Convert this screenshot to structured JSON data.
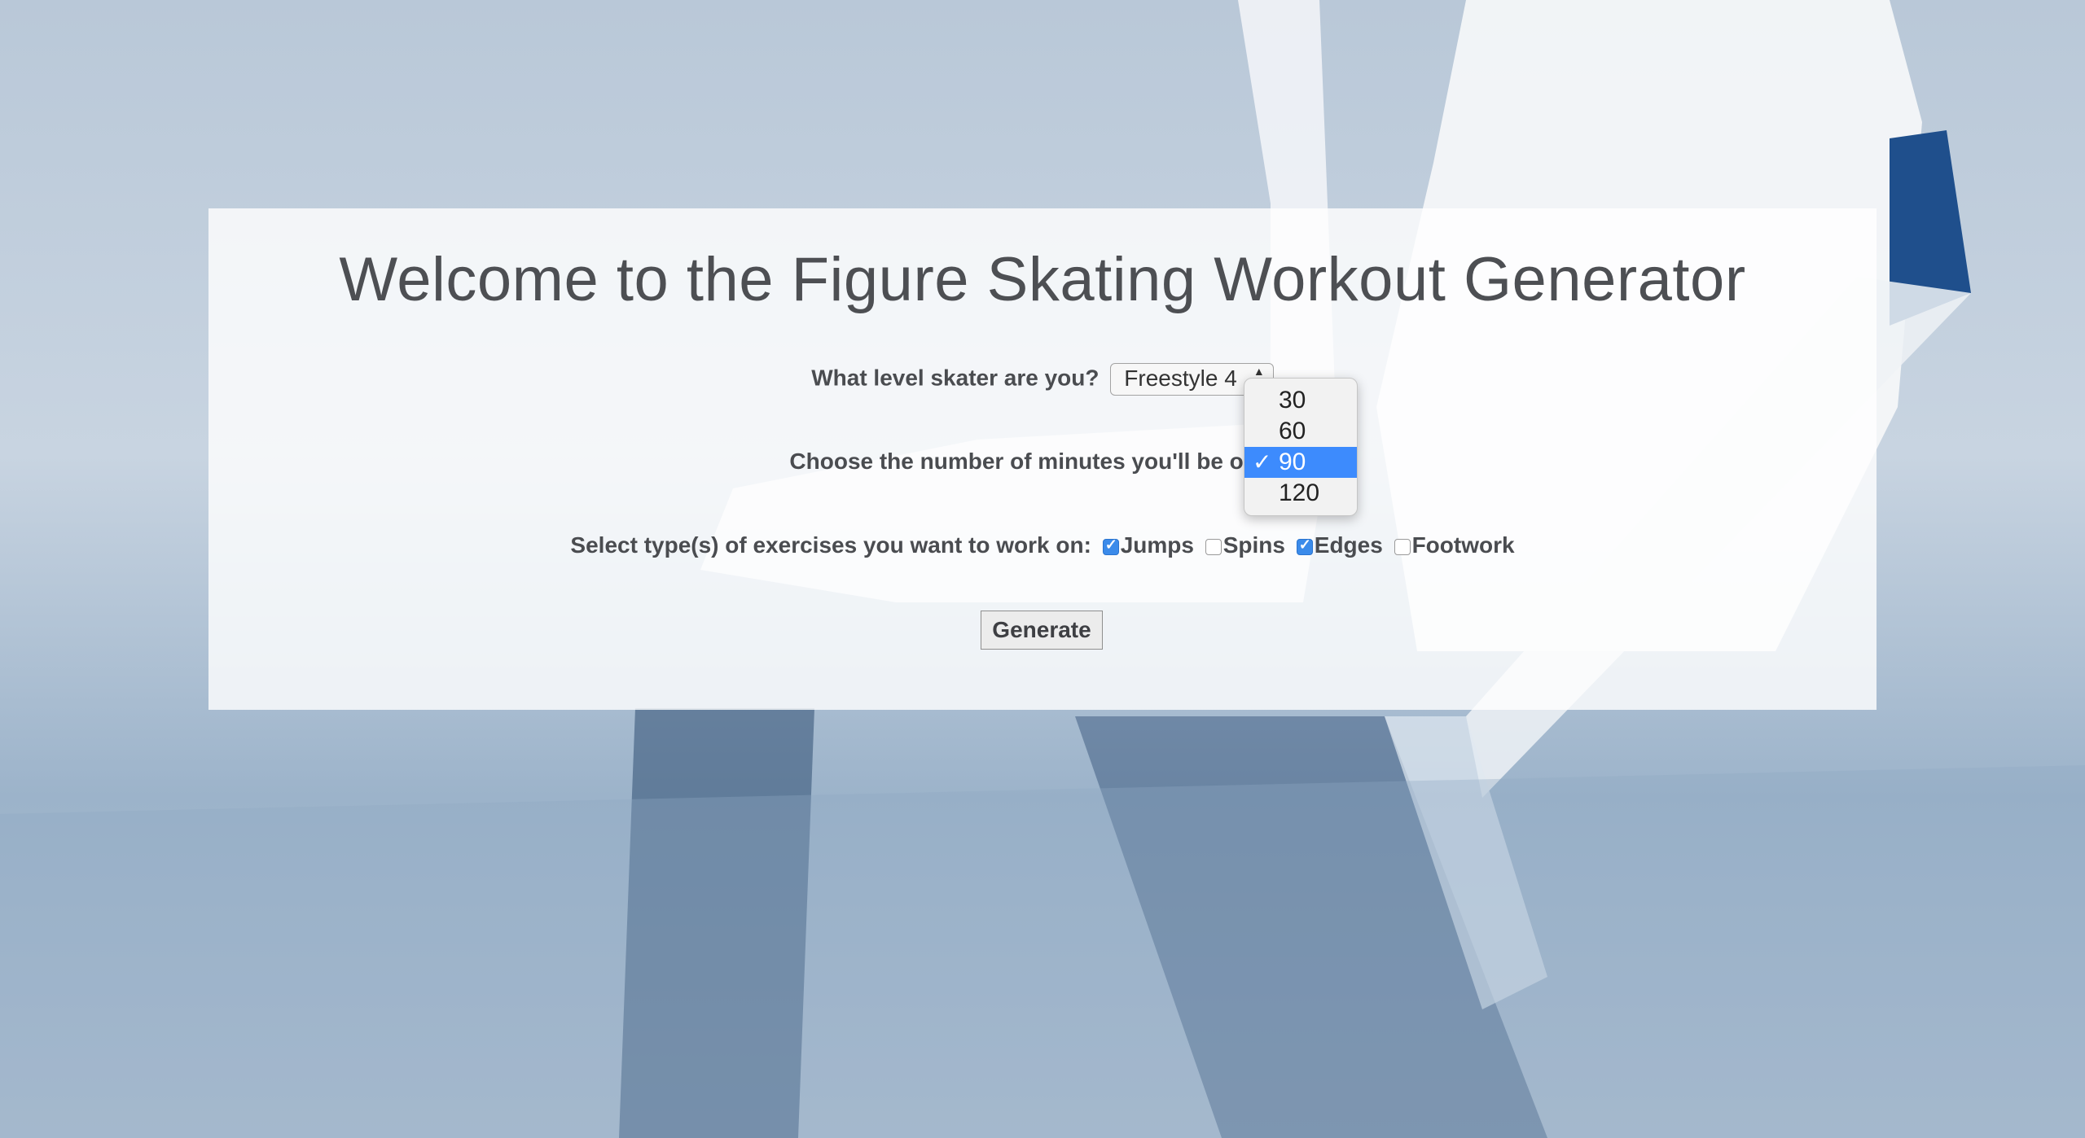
{
  "page": {
    "title": "Welcome to the Figure Skating Workout Generator"
  },
  "form": {
    "level_label": "What level skater are you?",
    "level_value": "Freestyle 4",
    "minutes_label": "Choose the number of minutes you'll be on ice",
    "minutes_options": [
      "30",
      "60",
      "90",
      "120"
    ],
    "minutes_selected": "90",
    "exercises_label": "Select type(s) of exercises you want to work on:",
    "exercises": [
      {
        "label": "Jumps",
        "checked": true
      },
      {
        "label": "Spins",
        "checked": false
      },
      {
        "label": "Edges",
        "checked": true
      },
      {
        "label": "Footwork",
        "checked": false
      }
    ],
    "generate_label": "Generate",
    "check_mark": "✓"
  },
  "colors": {
    "accent": "#3d8bfd",
    "text": "#4d4f53"
  }
}
